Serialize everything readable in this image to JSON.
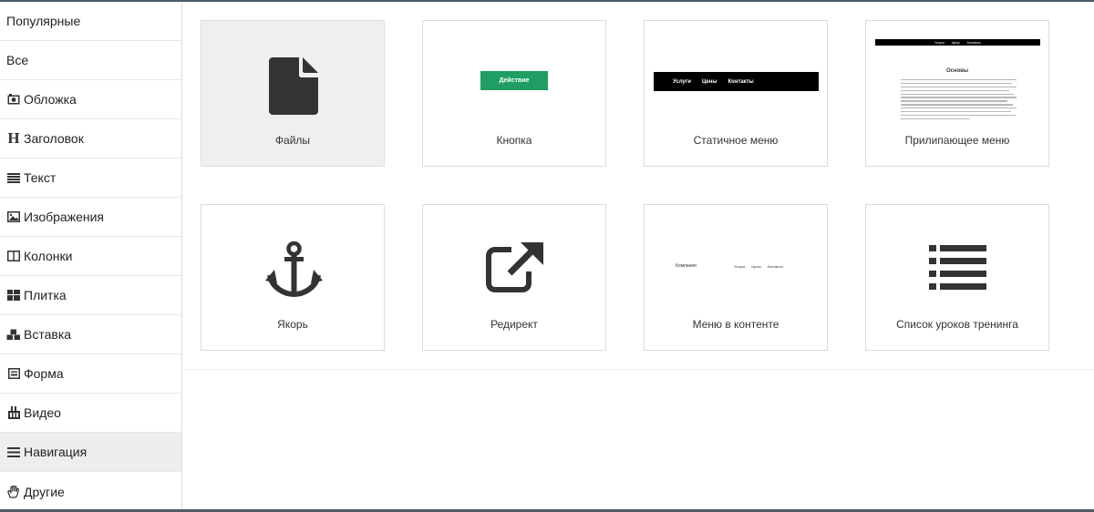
{
  "sidebar": {
    "items": [
      {
        "label": "Популярные",
        "icon": "",
        "active": false
      },
      {
        "label": "Все",
        "icon": "",
        "active": false
      },
      {
        "label": "Обложка",
        "icon": "camera-icon",
        "active": false
      },
      {
        "label": "Заголовок",
        "icon": "heading-icon",
        "active": false
      },
      {
        "label": "Текст",
        "icon": "text-lines-icon",
        "active": false
      },
      {
        "label": "Изображения",
        "icon": "image-icon",
        "active": false
      },
      {
        "label": "Колонки",
        "icon": "columns-icon",
        "active": false
      },
      {
        "label": "Плитка",
        "icon": "tiles-icon",
        "active": false
      },
      {
        "label": "Вставка",
        "icon": "cubes-icon",
        "active": false
      },
      {
        "label": "Форма",
        "icon": "form-icon",
        "active": false
      },
      {
        "label": "Видео",
        "icon": "video-icon",
        "active": false
      },
      {
        "label": "Навигация",
        "icon": "hamburger-icon",
        "active": true
      },
      {
        "label": "Другие",
        "icon": "hand-icon",
        "active": false
      }
    ]
  },
  "cards": [
    {
      "label": "Файлы",
      "icon": "file-icon",
      "selected": true
    },
    {
      "label": "Кнопка",
      "preview_button": "Действие"
    },
    {
      "label": "Статичное меню",
      "menu_items": [
        "Услуги",
        "Цены",
        "Контакты"
      ]
    },
    {
      "label": "Прилипающее меню",
      "sticky_items": [
        "Услуги",
        "Цены",
        "Контакты"
      ],
      "preview_title": "Основы"
    },
    {
      "label": "Якорь",
      "icon": "anchor-icon"
    },
    {
      "label": "Редирект",
      "icon": "external-link-icon"
    },
    {
      "label": "Меню в контенте",
      "brand": "Компания",
      "menu_items": [
        "Услуги",
        "Цены",
        "Контакты"
      ]
    },
    {
      "label": "Список уроков тренинга",
      "icon": "list-icon"
    }
  ],
  "colors": {
    "accent_green": "#1f9d62",
    "active_bg": "#eeeeee",
    "frame": "#4b5a64"
  }
}
